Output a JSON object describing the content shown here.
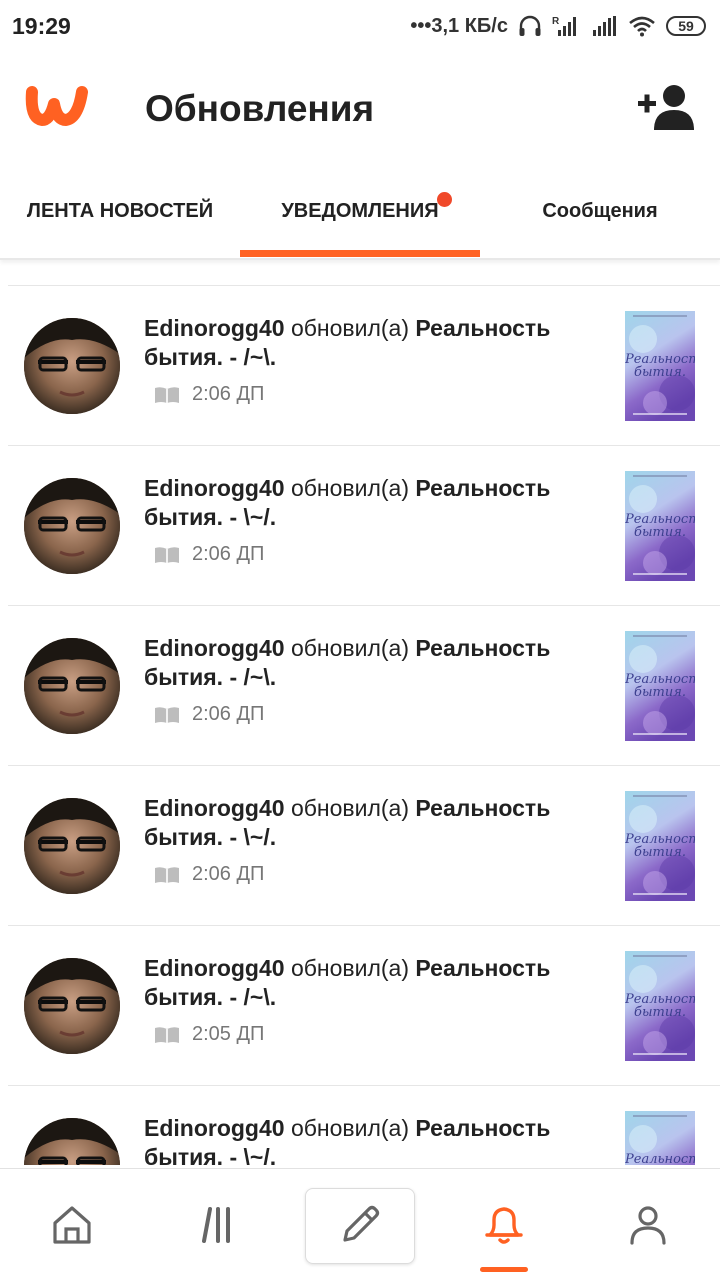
{
  "status_bar": {
    "time": "19:29",
    "speed": "•••3,1 КБ/с",
    "battery": "59",
    "icons": [
      "headphones-icon",
      "signal-roaming-icon",
      "signal-icon",
      "wifi-icon",
      "battery-icon"
    ]
  },
  "header": {
    "title": "Обновления",
    "logo_icon": "wattpad-logo-icon",
    "add_user_icon": "add-user-icon",
    "brand_color": "#ff6122"
  },
  "tabs": {
    "feed": "ЛЕНТА НОВОСТЕЙ",
    "notifications": "УВЕДОМЛЕНИЯ",
    "messages": "Сообщения",
    "active": "notifications",
    "badge_color": "#f0492a"
  },
  "notifications": [
    {
      "user": "Edinorogg40",
      "action": "обновил(а)",
      "story": "Реальность бытия. - /~\\.",
      "time": "2:06 ДП",
      "cover_title": "Реальность бытия."
    },
    {
      "user": "Edinorogg40",
      "action": "обновил(а)",
      "story": "Реальность бытия. - \\~/.",
      "time": "2:06 ДП",
      "cover_title": "Реальность бытия."
    },
    {
      "user": "Edinorogg40",
      "action": "обновил(а)",
      "story": "Реальность бытия. - /~\\.",
      "time": "2:06 ДП",
      "cover_title": "Реальность бытия."
    },
    {
      "user": "Edinorogg40",
      "action": "обновил(а)",
      "story": "Реальность бытия. - \\~/.",
      "time": "2:06 ДП",
      "cover_title": "Реальность бытия."
    },
    {
      "user": "Edinorogg40",
      "action": "обновил(а)",
      "story": "Реальность бытия. - /~\\.",
      "time": "2:05 ДП",
      "cover_title": "Реальность бытия."
    },
    {
      "user": "Edinorogg40",
      "action": "обновил(а)",
      "story": "Реальность бытия. - \\~/.",
      "time": "",
      "cover_title": "Реальность бытия."
    }
  ],
  "bottom_nav": {
    "items": [
      "home-icon",
      "library-icon",
      "write-icon",
      "bell-icon",
      "profile-icon"
    ],
    "active": "bell-icon",
    "active_color": "#ff6122",
    "inactive_color": "#666666"
  }
}
